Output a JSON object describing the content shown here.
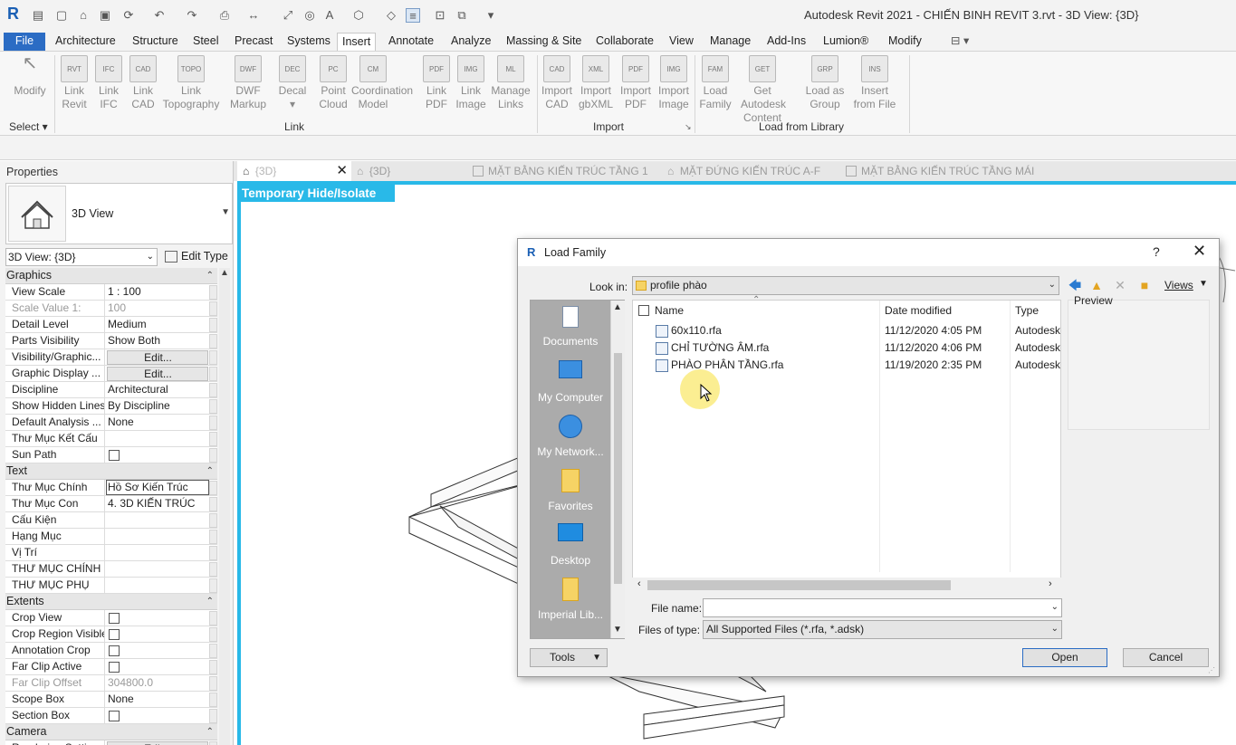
{
  "window": {
    "app_logo": "R",
    "title": "Autodesk Revit 2021 - CHIẾN BINH REVIT 3.rvt - 3D View: {3D}"
  },
  "ribbon": {
    "tabs": [
      "File",
      "Architecture",
      "Structure",
      "Steel",
      "Precast",
      "Systems",
      "Insert",
      "Annotate",
      "Analyze",
      "Massing & Site",
      "Collaborate",
      "View",
      "Manage",
      "Add-Ins",
      "Lumion®",
      "Modify"
    ],
    "active_tab": "Insert",
    "select": {
      "modify": "Modify",
      "select_label": "Select ▾"
    },
    "link_panel": {
      "label": "Link",
      "buttons": [
        {
          "l1": "Link",
          "l2": "Revit",
          "icon": "RVT"
        },
        {
          "l1": "Link",
          "l2": "IFC",
          "icon": "IFC"
        },
        {
          "l1": "Link",
          "l2": "CAD",
          "icon": "CAD"
        },
        {
          "l1": "Link",
          "l2": "Topography",
          "icon": "TOPO"
        },
        {
          "l1": "DWF",
          "l2": "Markup",
          "icon": "DWF"
        },
        {
          "l1": "Decal",
          "l2": "▾",
          "icon": "DEC"
        },
        {
          "l1": "Point",
          "l2": "Cloud",
          "icon": "PC"
        },
        {
          "l1": "Coordination",
          "l2": "Model",
          "icon": "CM"
        },
        {
          "l1": "Link",
          "l2": "PDF",
          "icon": "PDF"
        },
        {
          "l1": "Link",
          "l2": "Image",
          "icon": "IMG"
        },
        {
          "l1": "Manage",
          "l2": "Links",
          "icon": "ML"
        }
      ]
    },
    "import_panel": {
      "label": "Import",
      "buttons": [
        {
          "l1": "Import",
          "l2": "CAD",
          "icon": "CAD"
        },
        {
          "l1": "Import",
          "l2": "gbXML",
          "icon": "XML"
        },
        {
          "l1": "Import",
          "l2": "PDF",
          "icon": "PDF"
        },
        {
          "l1": "Import",
          "l2": "Image",
          "icon": "IMG"
        }
      ]
    },
    "library_panel": {
      "label": "Load from Library",
      "buttons": [
        {
          "l1": "Load",
          "l2": "Family",
          "icon": "FAM"
        },
        {
          "l1": "Get Autodesk",
          "l2": "Content",
          "icon": "GET"
        },
        {
          "l1": "Load as",
          "l2": "Group",
          "icon": "GRP"
        },
        {
          "l1": "Insert",
          "l2": "from File",
          "icon": "INS"
        }
      ]
    }
  },
  "properties": {
    "header": "Properties",
    "type_name": "3D View",
    "selector": "3D View: {3D}",
    "edit_type": "Edit Type",
    "groups": [
      {
        "name": "Graphics",
        "rows": [
          {
            "n": "View Scale",
            "v": "1 : 100"
          },
          {
            "n": "Scale Value    1:",
            "v": "100",
            "gray": true
          },
          {
            "n": "Detail Level",
            "v": "Medium"
          },
          {
            "n": "Parts Visibility",
            "v": "Show Both"
          },
          {
            "n": "Visibility/Graphic...",
            "v": "Edit...",
            "btn": true
          },
          {
            "n": "Graphic Display ...",
            "v": "Edit...",
            "btn": true
          },
          {
            "n": "Discipline",
            "v": "Architectural"
          },
          {
            "n": "Show Hidden Lines",
            "v": "By Discipline"
          },
          {
            "n": "Default Analysis ...",
            "v": "None"
          },
          {
            "n": "Thư Mục Kết Cấu",
            "v": ""
          },
          {
            "n": "Sun Path",
            "v": "",
            "chk": true
          }
        ]
      },
      {
        "name": "Text",
        "rows": [
          {
            "n": "Thư Mục Chính",
            "v": "Hồ Sơ Kiến Trúc",
            "boxed": true
          },
          {
            "n": "Thư Mục Con",
            "v": "4. 3D KIẾN TRÚC"
          },
          {
            "n": "Cấu Kiện",
            "v": ""
          },
          {
            "n": "Hạng Mục",
            "v": ""
          },
          {
            "n": "Vị Trí",
            "v": ""
          },
          {
            "n": "THƯ MỤC CHÍNH",
            "v": ""
          },
          {
            "n": "THƯ MỤC PHỤ",
            "v": ""
          }
        ]
      },
      {
        "name": "Extents",
        "rows": [
          {
            "n": "Crop View",
            "v": "",
            "chk": true
          },
          {
            "n": "Crop Region Visible",
            "v": "",
            "chk": true
          },
          {
            "n": "Annotation Crop",
            "v": "",
            "chk": true
          },
          {
            "n": "Far Clip Active",
            "v": "",
            "chk": true
          },
          {
            "n": "Far Clip Offset",
            "v": "304800.0",
            "gray": true
          },
          {
            "n": "Scope Box",
            "v": "None"
          },
          {
            "n": "Section Box",
            "v": "",
            "chk": true
          }
        ]
      },
      {
        "name": "Camera",
        "rows": [
          {
            "n": "Rendering Settings",
            "v": "Edit...",
            "btn": true
          }
        ]
      }
    ]
  },
  "view_tabs": [
    {
      "label": "{3D}",
      "active": true
    },
    {
      "label": "{3D}",
      "active": false
    },
    {
      "label": "MẶT BẰNG KIẾN TRÚC TẦNG 1",
      "active": false
    },
    {
      "label": "MẶT ĐỨNG KIẾN TRÚC A-F",
      "active": false
    },
    {
      "label": "MẶT BẰNG KIẾN TRÚC TẦNG MÁI",
      "active": false
    }
  ],
  "canvas": {
    "banner": "Temporary Hide/Isolate"
  },
  "dialog": {
    "title": "Load Family",
    "help": "?",
    "close": "✕",
    "look_in_label": "Look in:",
    "look_in_value": "profile phào",
    "views_label": "Views",
    "preview_label": "Preview",
    "places": [
      "Documents",
      "My Computer",
      "My Network...",
      "Favorites",
      "Desktop",
      "Imperial Lib..."
    ],
    "columns": [
      "Name",
      "Date modified",
      "Type"
    ],
    "files": [
      {
        "name": "60x110.rfa",
        "date": "11/12/2020 4:05 PM",
        "type": "Autodesk"
      },
      {
        "name": "CHỈ TƯỜNG ÂM.rfa",
        "date": "11/12/2020 4:06 PM",
        "type": "Autodesk"
      },
      {
        "name": "PHÀO PHÂN TẦNG.rfa",
        "date": "11/19/2020 2:35 PM",
        "type": "Autodesk"
      }
    ],
    "file_name_label": "File name:",
    "file_name_value": "",
    "files_of_type_label": "Files of type:",
    "files_of_type_value": "All Supported Files  (*.rfa, *.adsk)",
    "tools": "Tools",
    "open": "Open",
    "cancel": "Cancel"
  },
  "colors": {
    "accent": "#29b9e8",
    "file_tab": "#2b6cc4",
    "places_bg": "#ababab"
  }
}
